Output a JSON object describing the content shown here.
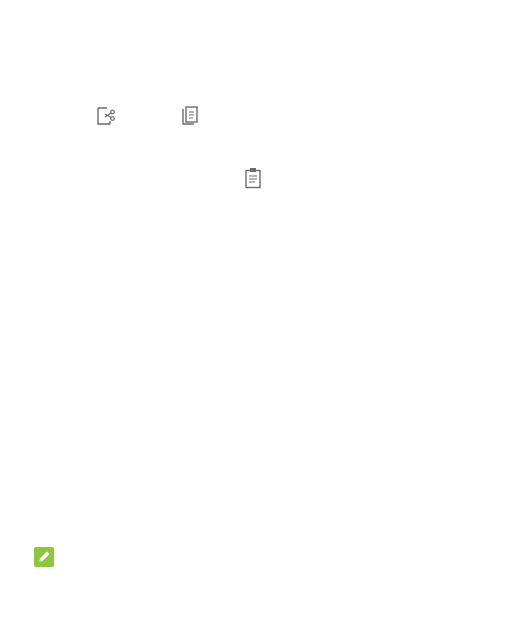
{
  "icons": {
    "cut": "cut-icon",
    "copy": "copy-icon",
    "paste": "paste-icon",
    "note": "pencil-note-icon"
  },
  "colors": {
    "icon_gray": "#6b6b6b",
    "note_green": "#8dc63f",
    "background": "#ffffff"
  }
}
